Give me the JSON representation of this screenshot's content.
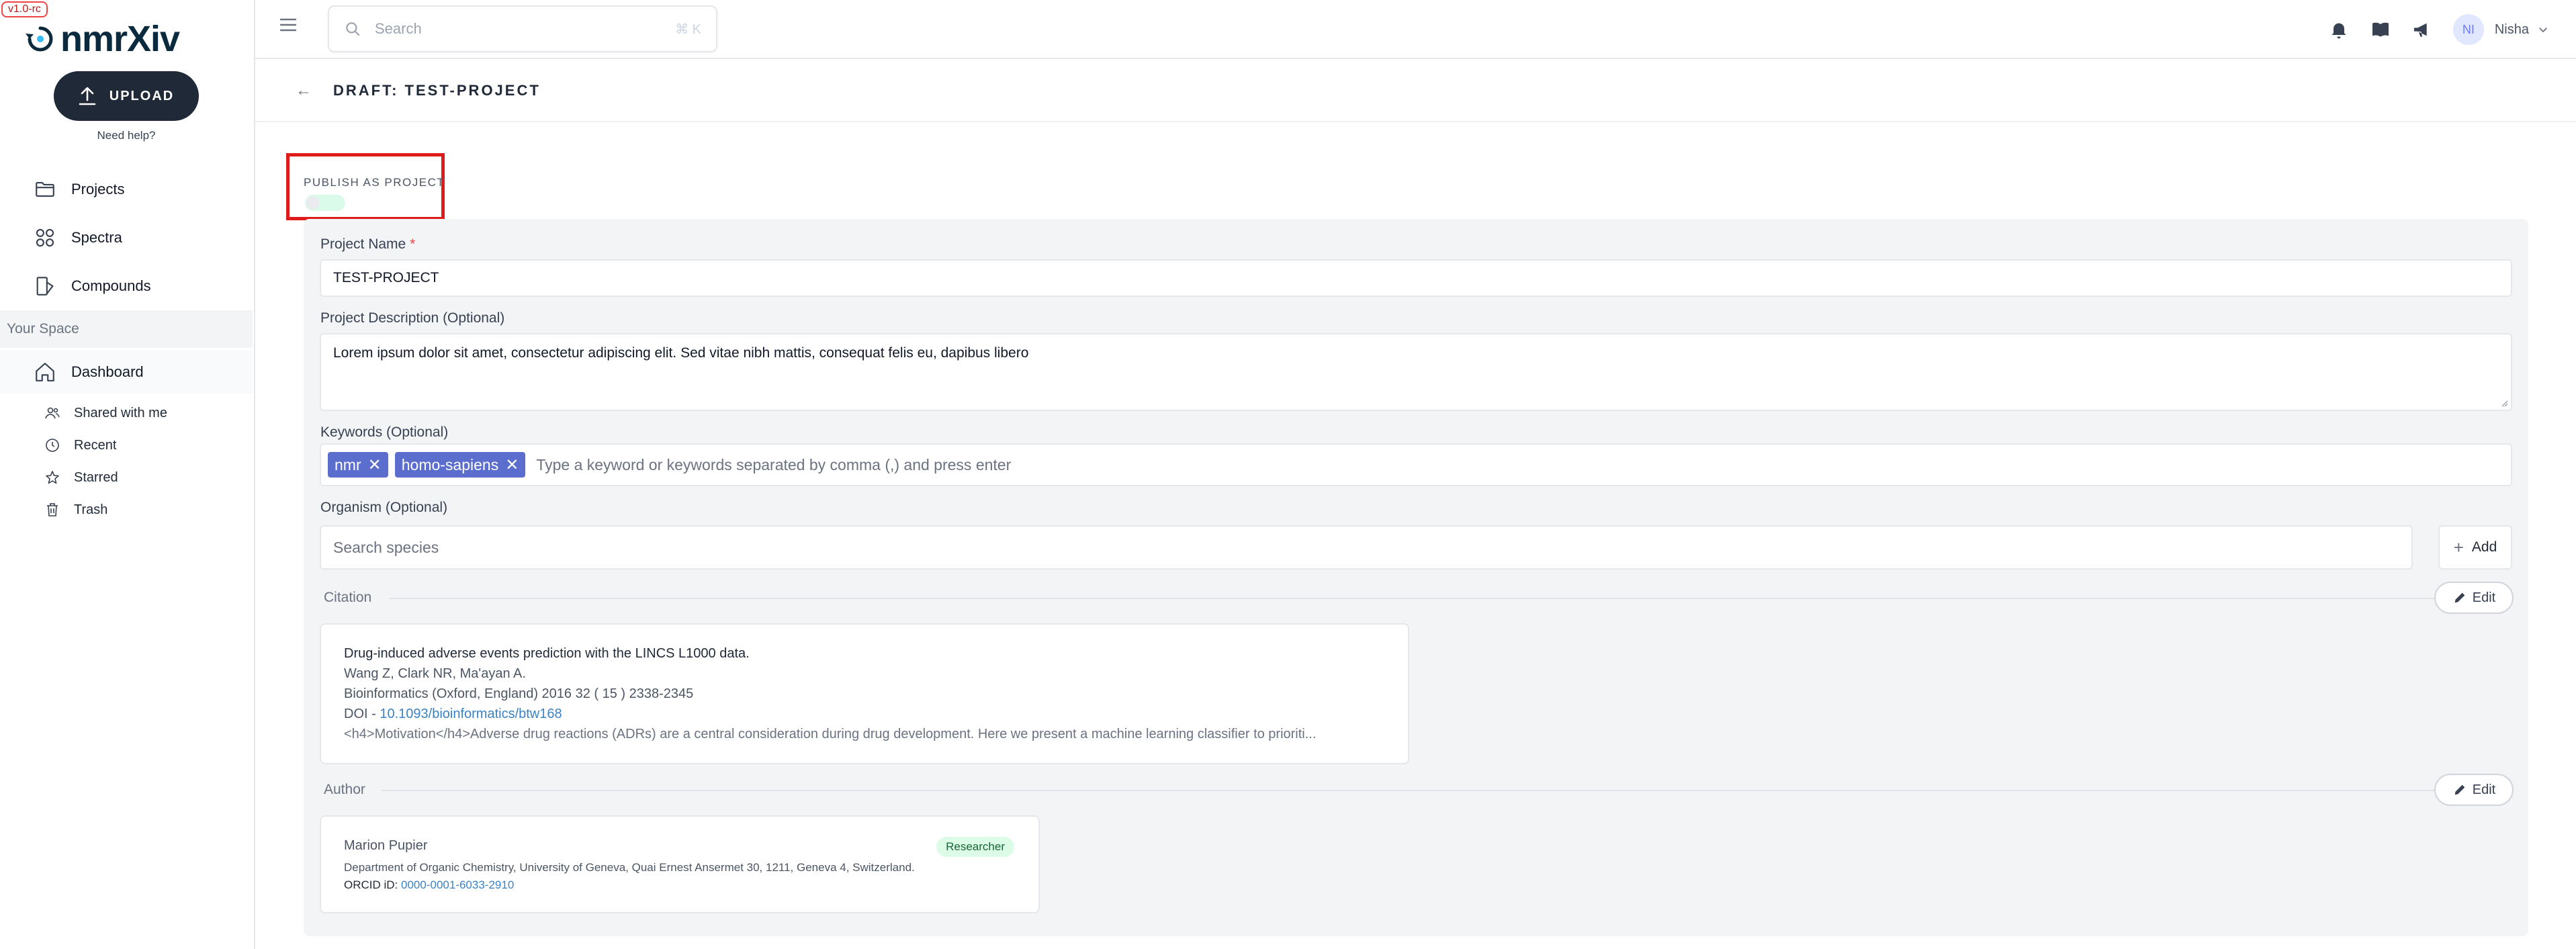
{
  "app": {
    "version": "v1.0-rc",
    "logo_text": "nmrXiv"
  },
  "sidebar": {
    "upload_label": "UPLOAD",
    "need_help": "Need help?",
    "nav": [
      {
        "label": "Projects",
        "icon": "folder-icon"
      },
      {
        "label": "Spectra",
        "icon": "grid-icon"
      },
      {
        "label": "Compounds",
        "icon": "molecule-icon"
      }
    ],
    "section_label": "Your Space",
    "dashboard_label": "Dashboard",
    "sub_items": [
      {
        "label": "Shared with me",
        "icon": "users-icon"
      },
      {
        "label": "Recent",
        "icon": "clock-icon"
      },
      {
        "label": "Starred",
        "icon": "star-icon"
      },
      {
        "label": "Trash",
        "icon": "trash-icon"
      }
    ]
  },
  "topbar": {
    "search_placeholder": "Search",
    "search_shortcut": "⌘ K",
    "user_initials": "NI",
    "user_name": "Nisha"
  },
  "header": {
    "back_label": "←",
    "title": "DRAFT: TEST-PROJECT"
  },
  "publish": {
    "label": "PUBLISH AS PROJECT",
    "enabled": false
  },
  "form": {
    "project_name_label": "Project Name",
    "required_mark": "*",
    "project_name_value": "TEST-PROJECT",
    "description_label": "Project Description (Optional)",
    "description_value": "Lorem ipsum dolor sit amet, consectetur adipiscing elit. Sed vitae nibh mattis, consequat felis eu, dapibus libero",
    "keywords_label": "Keywords (Optional)",
    "keywords": [
      "nmr",
      "homo-sapiens"
    ],
    "keywords_placeholder": "Type a keyword or keywords separated by comma (,) and press enter",
    "organism_label": "Organism (Optional)",
    "organism_placeholder": "Search species",
    "add_label": "Add"
  },
  "citation": {
    "section_title": "Citation",
    "edit_label": "Edit",
    "title": "Drug-induced adverse events prediction with the LINCS L1000 data.",
    "authors": "Wang Z, Clark NR, Ma'ayan A.",
    "journal": "Bioinformatics (Oxford, England) 2016 32 ( 15 ) 2338-2345",
    "doi_prefix": "DOI - ",
    "doi": "10.1093/bioinformatics/btw168",
    "abstract": "<h4>Motivation</h4>Adverse drug reactions (ADRs) are a central consideration during drug development. Here we present a machine learning classifier to prioriti..."
  },
  "author": {
    "section_title": "Author",
    "edit_label": "Edit",
    "name": "Marion Pupier",
    "role": "Researcher",
    "affiliation": "Department of Organic Chemistry, University of Geneva, Quai Ernest Ansermet 30, 1211, Geneva 4, Switzerland.",
    "orcid_label": "ORCID iD:",
    "orcid": "0000-0001-6033-2910"
  },
  "colors": {
    "primary_dark": "#1f2937",
    "chip": "#5b6dcd",
    "link": "#3b82c4",
    "highlight": "#e01b1b",
    "badge_bg": "#dcfce7"
  }
}
